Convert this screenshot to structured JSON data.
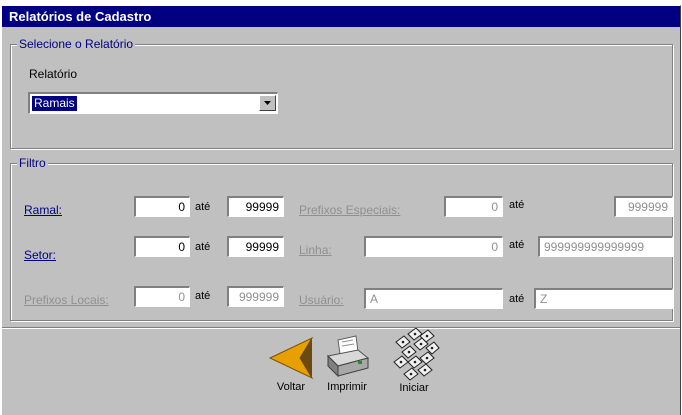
{
  "window": {
    "title": "Relatórios de Cadastro"
  },
  "selecao": {
    "legend": "Selecione o Relatório",
    "relatorio_label": "Relatório",
    "relatorio_value": "Ramais"
  },
  "filtro": {
    "legend": "Filtro",
    "ate": "até",
    "ramal": {
      "label": "Ramal:",
      "from": "0",
      "to": "99999"
    },
    "setor": {
      "label": "Setor:",
      "from": "0",
      "to": "99999"
    },
    "prefixos_locais": {
      "label": "Prefixos Locais:",
      "from": "0",
      "to": "999999"
    },
    "prefixos_especiais": {
      "label": "Prefixos Especiais:",
      "from": "0",
      "to": "999999"
    },
    "linha": {
      "label": "Linha:",
      "from": "0",
      "to": "999999999999999"
    },
    "usuario": {
      "label": "Usuário:",
      "from": "A",
      "to": "Z"
    }
  },
  "toolbar": {
    "voltar": "Voltar",
    "imprimir": "Imprimir",
    "iniciar": "Iniciar"
  },
  "icons": {
    "voltar": "arrow-left-icon",
    "imprimir": "printer-icon",
    "iniciar": "keypad-icon"
  }
}
